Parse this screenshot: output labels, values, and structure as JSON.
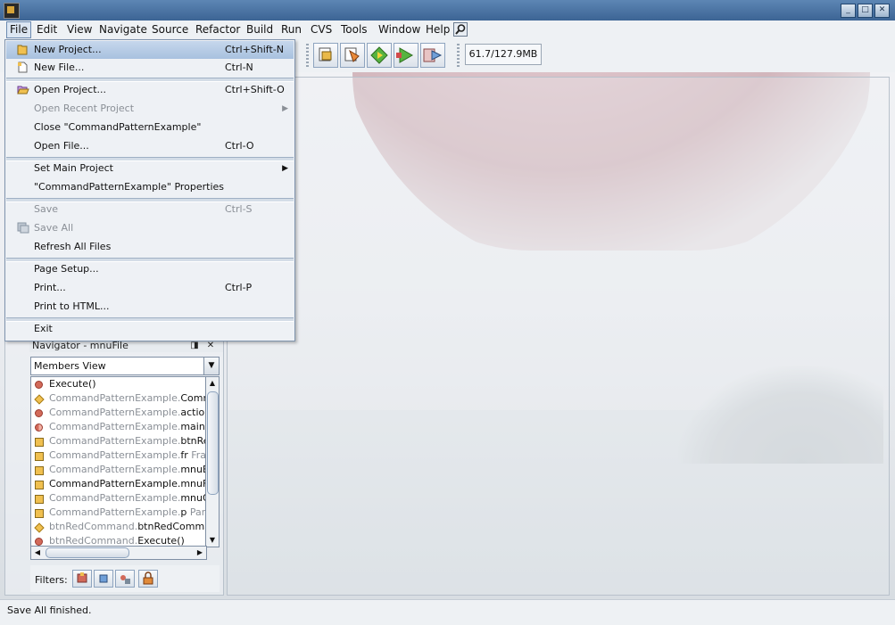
{
  "window": {
    "controls": {
      "minimize": "_",
      "maximize": "□",
      "close": "✕"
    }
  },
  "menubar": {
    "items": [
      "File",
      "Edit",
      "View",
      "Navigate",
      "Source",
      "Refactor",
      "Build",
      "Run",
      "CVS",
      "Tools",
      "Window",
      "Help"
    ]
  },
  "toolbar": {
    "memory": "61.7/127.9MB"
  },
  "file_menu": {
    "new_project": {
      "label": "New Project...",
      "shortcut": "Ctrl+Shift-N"
    },
    "new_file": {
      "label": "New File...",
      "shortcut": "Ctrl-N"
    },
    "open_project": {
      "label": "Open Project...",
      "shortcut": "Ctrl+Shift-O"
    },
    "open_recent_project": {
      "label": "Open Recent Project"
    },
    "close_project": {
      "label": "Close \"CommandPatternExample\""
    },
    "open_file": {
      "label": "Open File...",
      "shortcut": "Ctrl-O"
    },
    "set_main_project": {
      "label": "Set Main Project"
    },
    "project_properties": {
      "label": "\"CommandPatternExample\" Properties"
    },
    "save": {
      "label": "Save",
      "shortcut": "Ctrl-S"
    },
    "save_all": {
      "label": "Save All"
    },
    "refresh_all_files": {
      "label": "Refresh All Files"
    },
    "page_setup": {
      "label": "Page Setup..."
    },
    "print": {
      "label": "Print...",
      "shortcut": "Ctrl-P"
    },
    "print_to_html": {
      "label": "Print to HTML..."
    },
    "exit": {
      "label": "Exit"
    }
  },
  "navigator": {
    "title": "Navigator - mnuFile",
    "view_select": "Members View",
    "members": [
      {
        "icon": "method",
        "prefix": "",
        "name": "Execute()"
      },
      {
        "icon": "constructor",
        "prefix": "CommandPatternExample.",
        "name": "Comm"
      },
      {
        "icon": "method",
        "prefix": "CommandPatternExample.",
        "name": "action"
      },
      {
        "icon": "static-method",
        "prefix": "CommandPatternExample.",
        "name": "main(S"
      },
      {
        "icon": "field",
        "prefix": "CommandPatternExample.",
        "name": "btnRed"
      },
      {
        "icon": "field",
        "prefix": "CommandPatternExample.",
        "name": "fr",
        "suffix": " Fram"
      },
      {
        "icon": "field",
        "prefix": "CommandPatternExample.",
        "name": "mnuEx"
      },
      {
        "icon": "field",
        "prefix": "",
        "name": "CommandPatternExample.mnuFi"
      },
      {
        "icon": "field",
        "prefix": "CommandPatternExample.",
        "name": "mnuO"
      },
      {
        "icon": "field",
        "prefix": "CommandPatternExample.",
        "name": "p",
        "suffix": " Pane"
      },
      {
        "icon": "constructor",
        "prefix": "btnRedCommand.",
        "name": "btnRedComma"
      },
      {
        "icon": "method",
        "prefix": "btnRedCommand.",
        "name": "Execute()"
      }
    ],
    "filters_label": "Filters:"
  },
  "status": {
    "text": "Save All finished."
  }
}
